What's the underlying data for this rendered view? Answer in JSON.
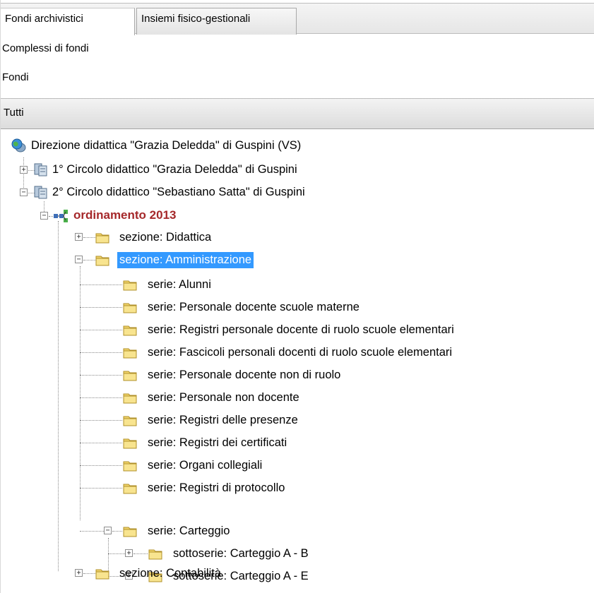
{
  "tabs": [
    {
      "label": "Fondi archivistici",
      "active": true
    },
    {
      "label": "Insiemi fisico-gestionali",
      "active": false
    }
  ],
  "filters": [
    {
      "label": "Complessi di fondi"
    },
    {
      "label": "Fondi"
    }
  ],
  "tutti_label": "Tutti",
  "tree": {
    "root": {
      "label": "Direzione didattica \"Grazia Deledda\" di Guspini (VS)",
      "icon": "globe-database-icon"
    },
    "circolo1": {
      "label": "1° Circolo didattico \"Grazia Deledda\" di Guspini",
      "icon": "database-icon"
    },
    "circolo2": {
      "label": "2° Circolo didattico \"Sebastiano Satta\" di Guspini",
      "icon": "database-icon"
    },
    "ordinamento": {
      "label": "ordinamento 2013",
      "icon": "hierarchy-icon",
      "color": "#a5282a"
    },
    "sez_didattica": {
      "label": "sezione: Didattica",
      "icon": "folder-icon"
    },
    "sez_amministrazione": {
      "label": "sezione: Amministrazione",
      "icon": "folder-icon",
      "selected": true,
      "selected_color": "#3399ff"
    },
    "serie": [
      "serie: Alunni",
      "serie: Personale docente scuole materne",
      "serie: Registri personale docente di ruolo scuole elementari",
      "serie: Fascicoli personali docenti di ruolo scuole elementari",
      "serie: Personale docente non di ruolo",
      "serie: Personale non docente",
      "serie: Registri delle presenze",
      "serie: Registri dei certificati",
      "serie: Organi collegiali",
      "serie: Registri di protocollo"
    ],
    "carteggio": {
      "label": "serie: Carteggio",
      "icon": "folder-icon"
    },
    "sottoserie": [
      "sottoserie: Carteggio A - B",
      "sottoserie: Carteggio A - E"
    ],
    "sez_contabilita": {
      "label": "sezione: Contabilità",
      "icon": "folder-icon"
    }
  }
}
